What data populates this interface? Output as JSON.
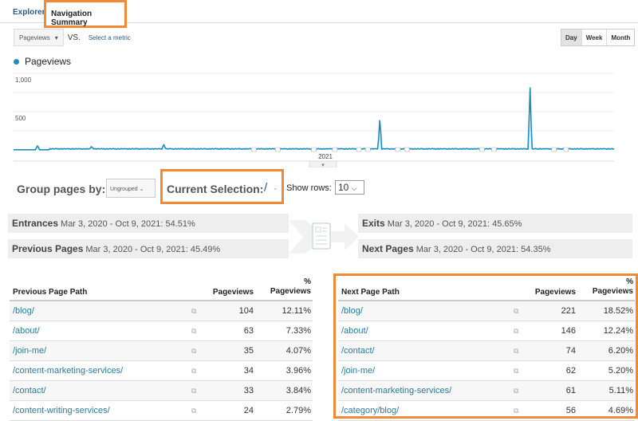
{
  "tabs": [
    {
      "label": "Explorer",
      "active": false
    },
    {
      "label": "Navigation Summary",
      "active": true
    }
  ],
  "metric_selector": {
    "value": "Pageviews",
    "vs_label": "VS.",
    "select_metric_link": "Select a metric"
  },
  "period_buttons": [
    {
      "label": "Day",
      "active": true
    },
    {
      "label": "Week",
      "active": false
    },
    {
      "label": "Month",
      "active": false
    }
  ],
  "chart_data": {
    "type": "line",
    "title": "",
    "legend": [
      "Pageviews"
    ],
    "series_color": "#1d8fbe",
    "y_ticks": [
      "1,000",
      "500"
    ],
    "ylim": [
      0,
      1000
    ],
    "x_label_tick": "2021",
    "x_range": [
      "Mar 3, 2020",
      "Oct 9, 2021"
    ],
    "series": [
      {
        "name": "Pageviews",
        "note": "daily values mostly near 10-20; notable spikes",
        "spikes": [
          {
            "position": 0.04,
            "value": 40
          },
          {
            "position": 0.13,
            "value": 30
          },
          {
            "position": 0.25,
            "value": 60
          },
          {
            "position": 0.61,
            "value": 420
          },
          {
            "position": 0.86,
            "value": 830
          }
        ],
        "baseline": 15
      }
    ]
  },
  "controls": {
    "group_label": "Group pages by:",
    "group_value": "Ungrouped",
    "current_selection_label": "Current Selection:",
    "current_selection_value": "/",
    "show_rows_label": "Show rows:",
    "show_rows_value": "10"
  },
  "summary": {
    "entrances": {
      "label": "Entrances",
      "text": "Mar 3, 2020 - Oct 9, 2021: 54.51%"
    },
    "previous": {
      "label": "Previous Pages",
      "text": "Mar 3, 2020 - Oct 9, 2021: 45.49%"
    },
    "exits": {
      "label": "Exits",
      "text": "Mar 3, 2020 - Oct 9, 2021: 45.65%"
    },
    "next": {
      "label": "Next Pages",
      "text": "Mar 3, 2020 - Oct 9, 2021: 54.35%"
    }
  },
  "previous_table": {
    "headers": {
      "path": "Previous Page Path",
      "pageviews": "Pageviews",
      "pct_symbol": "%",
      "pct": "Pageviews"
    },
    "rows": [
      {
        "path": "/blog/",
        "pageviews": "104",
        "pct": "12.11%"
      },
      {
        "path": "/about/",
        "pageviews": "63",
        "pct": "7.33%"
      },
      {
        "path": "/join-me/",
        "pageviews": "35",
        "pct": "4.07%"
      },
      {
        "path": "/content-marketing-services/",
        "pageviews": "34",
        "pct": "3.96%"
      },
      {
        "path": "/contact/",
        "pageviews": "33",
        "pct": "3.84%"
      },
      {
        "path": "/content-writing-services/",
        "pageviews": "24",
        "pct": "2.79%"
      }
    ]
  },
  "next_table": {
    "headers": {
      "path": "Next Page Path",
      "pageviews": "Pageviews",
      "pct_symbol": "%",
      "pct": "Pageviews"
    },
    "rows": [
      {
        "path": "/blog/",
        "pageviews": "221",
        "pct": "18.52%"
      },
      {
        "path": "/about/",
        "pageviews": "146",
        "pct": "12.24%"
      },
      {
        "path": "/contact/",
        "pageviews": "74",
        "pct": "6.20%"
      },
      {
        "path": "/join-me/",
        "pageviews": "62",
        "pct": "5.20%"
      },
      {
        "path": "/content-marketing-services/",
        "pageviews": "61",
        "pct": "5.11%"
      },
      {
        "path": "/category/blog/",
        "pageviews": "56",
        "pct": "4.69%"
      }
    ]
  },
  "highlight_color": "#f08a36"
}
